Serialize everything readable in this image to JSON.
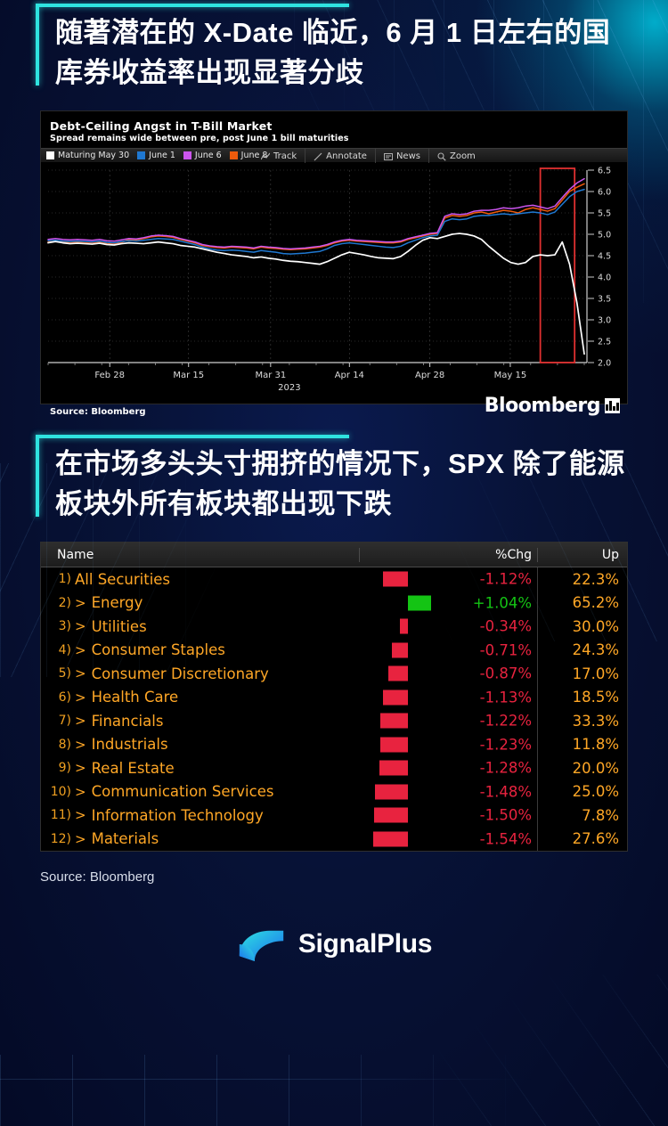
{
  "theme": {
    "bg_dark": "#040a26",
    "accent_cyan": "#2fe3e0",
    "headline_color": "#ffffff",
    "orange": "#ffa726",
    "red": "#e8233f",
    "green": "#14c414"
  },
  "headline1": "随著潜在的 X-Date 临近，6 月 1 日左右的国库券收益率出现显著分歧",
  "headline2": "在市场多头头寸拥挤的情况下，SPX 除了能源板块外所有板块都出现下跌",
  "bloomberg_chart": {
    "title": "Debt-Ceiling Angst in T-Bill Market",
    "subtitle": "Spread remains wide between pre, post June 1 bill maturities",
    "legend": [
      {
        "label": "Maturing May 30",
        "color": "#ffffff"
      },
      {
        "label": "June 1",
        "color": "#1f78d1"
      },
      {
        "label": "June 6",
        "color": "#cc55ee"
      },
      {
        "label": "June 8",
        "color": "#ef5b0c"
      }
    ],
    "toolbar": [
      {
        "label": "Track",
        "icon": "track-icon"
      },
      {
        "label": "Annotate",
        "icon": "annotate-icon"
      },
      {
        "label": "News",
        "icon": "news-icon"
      },
      {
        "label": "Zoom",
        "icon": "zoom-icon"
      }
    ],
    "source": "Source: Bloomberg",
    "brand": "Bloomberg",
    "chart_data": {
      "type": "line",
      "title": "Debt-Ceiling Angst in T-Bill Market",
      "subtitle": "Spread remains wide between pre, post June 1 bill maturities",
      "xlabel": "2023",
      "ylabel": "",
      "ylim": [
        2.0,
        6.5
      ],
      "yticks": [
        2.0,
        2.5,
        3.0,
        3.5,
        4.0,
        4.5,
        5.0,
        5.5,
        6.0,
        6.5
      ],
      "ytick_labels": [
        "2.0",
        "2.5",
        "3.0",
        "3.5",
        "4.0",
        "4.5",
        "5.0",
        "5.5",
        "6.0",
        "6.5"
      ],
      "xticks": [
        "Feb 28",
        "Mar 15",
        "Mar 31",
        "Apr 14",
        "Apr 28",
        "May 15"
      ],
      "xtick_positions": [
        0.115,
        0.262,
        0.415,
        0.562,
        0.712,
        0.862
      ],
      "grid": true,
      "legend_position": "top-left",
      "annotations": [
        {
          "type": "box",
          "color": "#e03030",
          "x_from": 0.918,
          "x_to": 0.982,
          "label": "divergence-highlight"
        }
      ],
      "series": [
        {
          "name": "Maturing May 30",
          "color": "#ffffff",
          "values": [
            4.8,
            4.83,
            4.8,
            4.78,
            4.79,
            4.78,
            4.77,
            4.79,
            4.76,
            4.75,
            4.78,
            4.8,
            4.79,
            4.78,
            4.8,
            4.82,
            4.8,
            4.78,
            4.74,
            4.72,
            4.7,
            4.66,
            4.62,
            4.58,
            4.55,
            4.52,
            4.5,
            4.48,
            4.45,
            4.47,
            4.44,
            4.42,
            4.39,
            4.37,
            4.36,
            4.34,
            4.32,
            4.3,
            4.36,
            4.44,
            4.52,
            4.58,
            4.55,
            4.52,
            4.48,
            4.45,
            4.44,
            4.43,
            4.48,
            4.6,
            4.74,
            4.86,
            4.92,
            4.9,
            4.95,
            5.0,
            5.02,
            5.0,
            4.96,
            4.88,
            4.72,
            4.58,
            4.44,
            4.34,
            4.3,
            4.34,
            4.48,
            4.52,
            4.5,
            4.52,
            4.82,
            4.3,
            3.4,
            2.2
          ]
        },
        {
          "name": "June 1",
          "color": "#1f78d1",
          "values": [
            4.85,
            4.86,
            4.84,
            4.83,
            4.84,
            4.83,
            4.82,
            4.84,
            4.81,
            4.8,
            4.83,
            4.85,
            4.84,
            4.86,
            4.88,
            4.9,
            4.89,
            4.88,
            4.84,
            4.8,
            4.76,
            4.7,
            4.66,
            4.63,
            4.62,
            4.63,
            4.62,
            4.6,
            4.58,
            4.62,
            4.6,
            4.58,
            4.55,
            4.54,
            4.55,
            4.56,
            4.58,
            4.6,
            4.66,
            4.74,
            4.78,
            4.8,
            4.78,
            4.76,
            4.74,
            4.72,
            4.7,
            4.69,
            4.72,
            4.8,
            4.86,
            4.92,
            4.96,
            4.98,
            5.3,
            5.36,
            5.34,
            5.36,
            5.42,
            5.44,
            5.44,
            5.46,
            5.48,
            5.46,
            5.48,
            5.5,
            5.52,
            5.5,
            5.46,
            5.52,
            5.7,
            5.88,
            6.0,
            6.05
          ]
        },
        {
          "name": "June 6",
          "color": "#cc55ee",
          "values": [
            4.88,
            4.9,
            4.88,
            4.87,
            4.88,
            4.87,
            4.86,
            4.88,
            4.85,
            4.84,
            4.87,
            4.9,
            4.89,
            4.92,
            4.96,
            4.98,
            4.97,
            4.95,
            4.9,
            4.86,
            4.82,
            4.76,
            4.73,
            4.71,
            4.7,
            4.72,
            4.71,
            4.7,
            4.68,
            4.72,
            4.7,
            4.69,
            4.67,
            4.66,
            4.67,
            4.68,
            4.7,
            4.72,
            4.76,
            4.82,
            4.86,
            4.88,
            4.86,
            4.85,
            4.84,
            4.83,
            4.82,
            4.82,
            4.84,
            4.9,
            4.94,
            4.98,
            5.02,
            5.04,
            5.42,
            5.48,
            5.46,
            5.48,
            5.54,
            5.56,
            5.56,
            5.58,
            5.62,
            5.6,
            5.62,
            5.66,
            5.68,
            5.64,
            5.6,
            5.66,
            5.86,
            6.05,
            6.2,
            6.3
          ]
        },
        {
          "name": "June 8",
          "color": "#ef5b0c",
          "values": [
            4.82,
            4.84,
            4.82,
            4.81,
            4.82,
            4.81,
            4.8,
            4.82,
            4.79,
            4.78,
            4.81,
            4.88,
            4.87,
            4.9,
            4.94,
            4.96,
            4.95,
            4.93,
            4.88,
            4.84,
            4.8,
            4.74,
            4.71,
            4.69,
            4.68,
            4.7,
            4.69,
            4.68,
            4.66,
            4.7,
            4.68,
            4.67,
            4.65,
            4.64,
            4.65,
            4.66,
            4.68,
            4.7,
            4.74,
            4.8,
            4.84,
            4.86,
            4.84,
            4.83,
            4.82,
            4.81,
            4.8,
            4.8,
            4.82,
            4.88,
            4.92,
            4.96,
            5.0,
            5.02,
            5.38,
            5.44,
            5.42,
            5.44,
            5.5,
            5.52,
            5.48,
            5.52,
            5.56,
            5.54,
            5.5,
            5.58,
            5.62,
            5.58,
            5.54,
            5.6,
            5.8,
            6.0,
            6.1,
            6.18
          ]
        }
      ]
    }
  },
  "sector_table": {
    "columns": [
      "Name",
      "%Chg",
      "Up"
    ],
    "bar_zero_offset_pct": 27,
    "rows": [
      {
        "num": "1)",
        "expander": "",
        "name": "All Securities",
        "chg": "-1.12%",
        "chg_value": -1.12,
        "up": "22.3%",
        "positive": false
      },
      {
        "num": "2)",
        "expander": ">",
        "name": "Energy",
        "chg": "+1.04%",
        "chg_value": 1.04,
        "up": "65.2%",
        "positive": true
      },
      {
        "num": "3)",
        "expander": ">",
        "name": "Utilities",
        "chg": "-0.34%",
        "chg_value": -0.34,
        "up": "30.0%",
        "positive": false
      },
      {
        "num": "4)",
        "expander": ">",
        "name": "Consumer Staples",
        "chg": "-0.71%",
        "chg_value": -0.71,
        "up": "24.3%",
        "positive": false
      },
      {
        "num": "5)",
        "expander": ">",
        "name": "Consumer Discretionary",
        "chg": "-0.87%",
        "chg_value": -0.87,
        "up": "17.0%",
        "positive": false
      },
      {
        "num": "6)",
        "expander": ">",
        "name": "Health Care",
        "chg": "-1.13%",
        "chg_value": -1.13,
        "up": "18.5%",
        "positive": false
      },
      {
        "num": "7)",
        "expander": ">",
        "name": "Financials",
        "chg": "-1.22%",
        "chg_value": -1.22,
        "up": "33.3%",
        "positive": false
      },
      {
        "num": "8)",
        "expander": ">",
        "name": "Industrials",
        "chg": "-1.23%",
        "chg_value": -1.23,
        "up": "11.8%",
        "positive": false
      },
      {
        "num": "9)",
        "expander": ">",
        "name": "Real Estate",
        "chg": "-1.28%",
        "chg_value": -1.28,
        "up": "20.0%",
        "positive": false
      },
      {
        "num": "10)",
        "expander": ">",
        "name": "Communication Services",
        "chg": "-1.48%",
        "chg_value": -1.48,
        "up": "25.0%",
        "positive": false
      },
      {
        "num": "11)",
        "expander": ">",
        "name": "Information Technology",
        "chg": "-1.50%",
        "chg_value": -1.5,
        "up": "7.8%",
        "positive": false
      },
      {
        "num": "12)",
        "expander": ">",
        "name": "Materials",
        "chg": "-1.54%",
        "chg_value": -1.54,
        "up": "27.6%",
        "positive": false
      }
    ]
  },
  "source_note": "Source: Bloomberg",
  "footer": {
    "brand": "SignalPlus"
  }
}
